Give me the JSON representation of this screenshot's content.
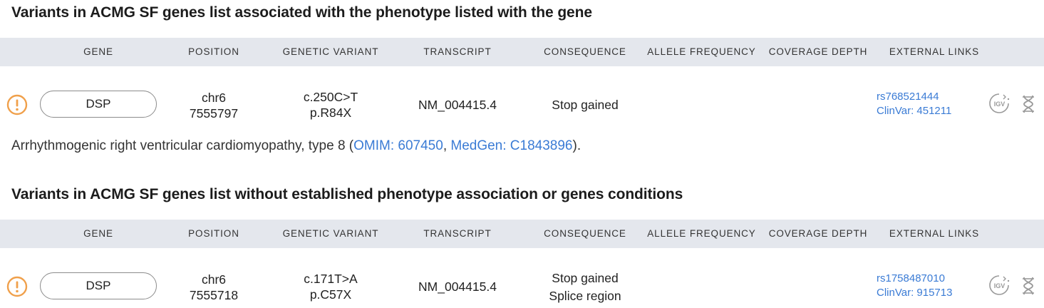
{
  "columns": [
    "GENE",
    "POSITION",
    "GENETIC VARIANT",
    "TRANSCRIPT",
    "CONSEQUENCE",
    "ALLELE FREQUENCY",
    "COVERAGE DEPTH",
    "EXTERNAL LINKS"
  ],
  "sections": [
    {
      "title": "Variants in ACMG SF genes list associated with the phenotype listed with the gene",
      "rows": [
        {
          "gene": "DSP",
          "position": [
            "chr6",
            "7555797"
          ],
          "variant": [
            "c.250C>T",
            "p.R84X"
          ],
          "transcript": "NM_004415.4",
          "consequence": [
            "Stop gained"
          ],
          "links": [
            "rs768521444",
            "ClinVar: 451211"
          ]
        }
      ],
      "phenotype": {
        "text": "Arrhythmogenic right ventricular cardiomyopathy, type 8 (",
        "link1": "OMIM: 607450",
        "sep": ", ",
        "link2": "MedGen: C1843896",
        "end": ")."
      }
    },
    {
      "title": "Variants in ACMG SF genes list without established phenotype association or genes conditions",
      "rows": [
        {
          "gene": "DSP",
          "position": [
            "chr6",
            "7555718"
          ],
          "variant": [
            "c.171T>A",
            "p.C57X"
          ],
          "transcript": "NM_004415.4",
          "consequence": [
            "Stop gained",
            "Splice region"
          ],
          "links": [
            "rs1758487010",
            "ClinVar: 915713"
          ]
        }
      ]
    }
  ],
  "icons": {
    "warning": "warning-circle-icon",
    "igv": "igv-icon",
    "dna": "dna-icon",
    "igv_text": "IGV"
  },
  "colors": {
    "warning": "#f0a04b",
    "link": "#3a7bd5",
    "header_bg": "#e4e7ed"
  }
}
